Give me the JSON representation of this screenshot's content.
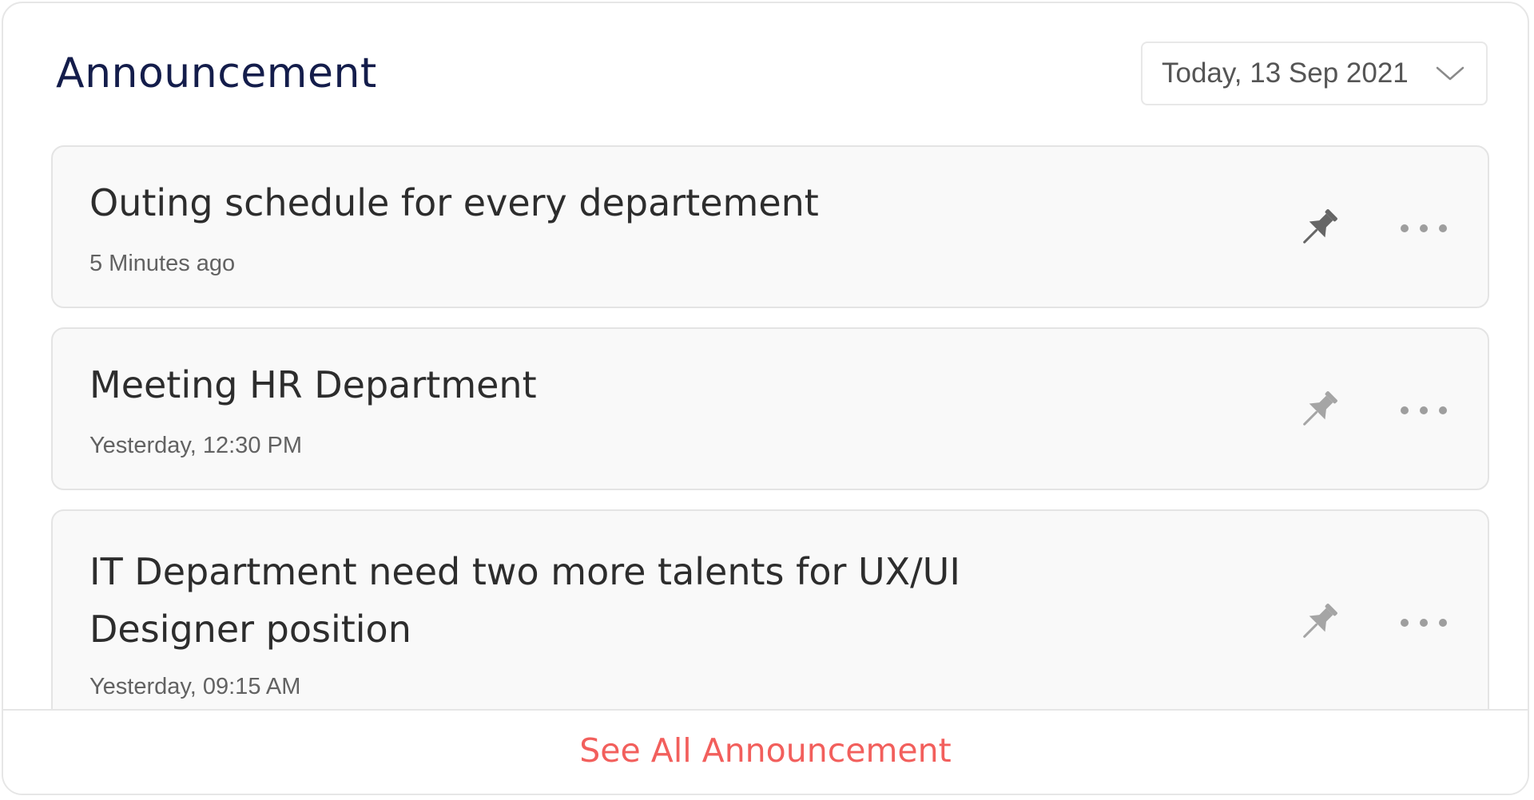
{
  "header": {
    "title": "Announcement",
    "date_filter": {
      "selected": "Today, 13 Sep 2021",
      "icon": "chevron-down-icon"
    }
  },
  "announcements": [
    {
      "title_lines": [
        "Outing schedule for every departement"
      ],
      "time": "5 Minutes ago",
      "pinned": true
    },
    {
      "title_lines": [
        "Meeting HR Department"
      ],
      "time": "Yesterday, 12:30 PM",
      "pinned": false
    },
    {
      "title_lines": [
        "IT Department need two more talents for UX/UI",
        "Designer position"
      ],
      "time": "Yesterday, 09:15 AM",
      "pinned": false
    }
  ],
  "footer": {
    "see_all_label": "See All Announcement"
  },
  "colors": {
    "title": "#141d4b",
    "accent": "#f25f5c",
    "pin_active": "#666666",
    "pin_inactive": "#a5a5a5",
    "more_dots": "#9e9e9e"
  }
}
